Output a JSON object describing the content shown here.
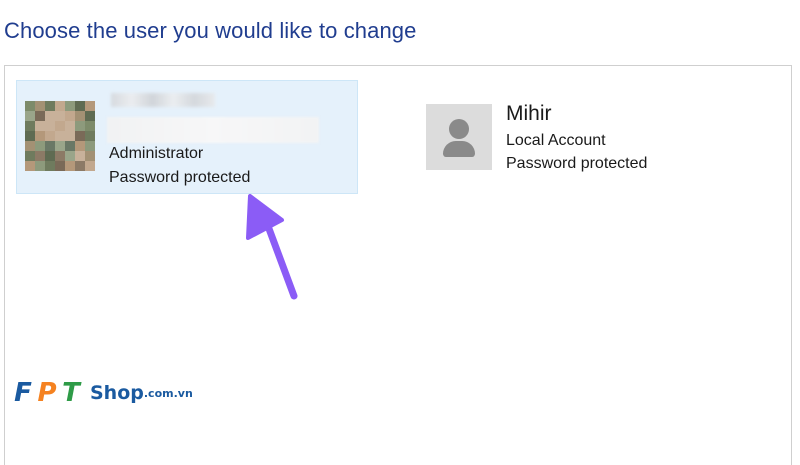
{
  "page_title": "Choose the user you would like to change",
  "users": [
    {
      "name": "",
      "role": "Administrator",
      "status": "Password protected",
      "selected": true,
      "avatar": "photo-blurred"
    },
    {
      "name": "Mihir",
      "role": "Local Account",
      "status": "Password protected",
      "selected": false,
      "avatar": "user-silhouette-icon"
    }
  ],
  "annotation": {
    "icon": "arrow-icon",
    "color": "#8b5cf6"
  },
  "watermark": {
    "brand": "FPT",
    "brand_colors": [
      "#1a5aa0",
      "#f58220",
      "#2e9b47"
    ],
    "shop_label": "Shop",
    "domain_label": ".com.vn"
  },
  "colors": {
    "title": "#203d8f",
    "selected_tile": "#e5f1fb"
  }
}
